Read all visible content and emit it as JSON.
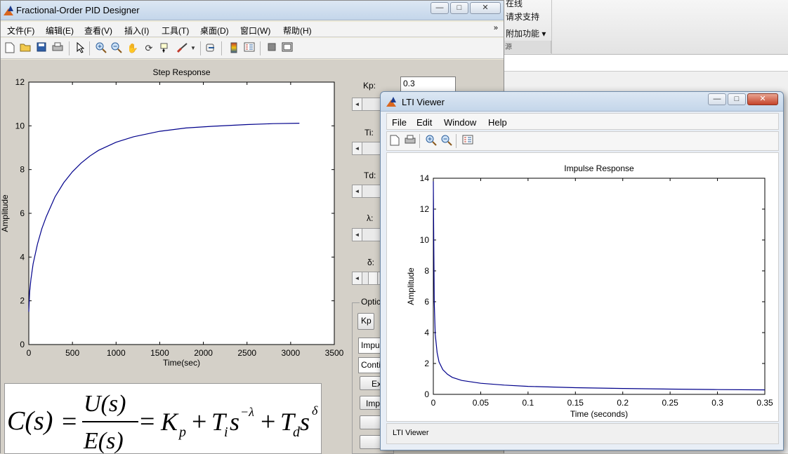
{
  "background_window": {
    "ribbon_items": [
      "在线",
      "请求支持",
      "附加功能 ▾"
    ],
    "group_label": "源"
  },
  "main_window": {
    "title": "Fractional-Order PID Designer",
    "controls": [
      "—",
      "□",
      "✕"
    ],
    "menu": [
      "文件(F)",
      "编辑(E)",
      "查看(V)",
      "插入(I)",
      "工具(T)",
      "桌面(D)",
      "窗口(W)",
      "帮助(H)"
    ],
    "menu_overflow": "»",
    "toolbar_icons": [
      "new-figure-icon",
      "open-icon",
      "save-icon",
      "print-icon",
      "pointer-icon",
      "zoom-in-icon",
      "zoom-out-icon",
      "pan-icon",
      "rotate-icon",
      "data-cursor-icon",
      "brush-icon",
      "link-icon",
      "colorbar-icon",
      "legend-icon",
      "hide-tools-icon",
      "show-tools-icon"
    ],
    "params": {
      "kp_label": "Kp:",
      "kp_value": "0.3",
      "ti_label": "Ti:",
      "td_label": "Td:",
      "lambda_label": "λ:",
      "delta_label": "δ:"
    },
    "options": {
      "title": "Optic",
      "kp_button": "Kp",
      "popup1": "Impu",
      "popup2": "Conti",
      "btn_ex": "Ex",
      "btn_imp": "Imp"
    },
    "equation": {
      "lhs": "C(s)",
      "num": "U(s)",
      "den": "E(s)",
      "kp": "K",
      "kp_sub": "p",
      "ti": "T",
      "ti_sub": "i",
      "lambda_exp": "−λ",
      "td": "T",
      "td_sub": "d",
      "delta_exp": "δ",
      "s": "s",
      "plus": "+",
      "eq": "="
    }
  },
  "lti_window": {
    "title": "LTI Viewer",
    "menu": [
      "File",
      "Edit",
      "Window",
      "Help"
    ],
    "toolbar_icons": [
      "new-icon",
      "print-icon",
      "zoom-in-icon",
      "zoom-out-icon",
      "legend-icon"
    ],
    "status": "LTI Viewer"
  },
  "chart_data": [
    {
      "type": "line",
      "title": "Step Response",
      "xlabel": "Time(sec)",
      "ylabel": "Amplitude",
      "xlim": [
        0,
        3500
      ],
      "ylim": [
        0,
        12
      ],
      "xticks": [
        0,
        500,
        1000,
        1500,
        2000,
        2500,
        3000,
        3500
      ],
      "yticks": [
        0,
        2,
        4,
        6,
        8,
        10,
        12
      ],
      "series": [
        {
          "color": "#00008b",
          "x": [
            0,
            10,
            25,
            50,
            100,
            150,
            200,
            300,
            400,
            500,
            600,
            700,
            800,
            1000,
            1200,
            1500,
            1800,
            2100,
            2500,
            2800,
            3100
          ],
          "y": [
            1.5,
            2.4,
            3.0,
            3.7,
            4.6,
            5.3,
            5.85,
            6.75,
            7.4,
            7.9,
            8.3,
            8.62,
            8.88,
            9.25,
            9.5,
            9.75,
            9.9,
            9.98,
            10.06,
            10.1,
            10.12
          ]
        }
      ]
    },
    {
      "type": "line",
      "title": "Impulse Response",
      "xlabel": "Time (seconds)",
      "ylabel": "Amplitude",
      "xlim": [
        0,
        0.35
      ],
      "ylim": [
        0,
        14
      ],
      "xticks": [
        0,
        0.05,
        0.1,
        0.15,
        0.2,
        0.25,
        0.3,
        0.35
      ],
      "xtick_labels": [
        "0",
        "0.05",
        "0.1",
        "0.15",
        "0.2",
        "0.25",
        "0.3",
        "0.35"
      ],
      "yticks": [
        0,
        2,
        4,
        6,
        8,
        10,
        12,
        14
      ],
      "series": [
        {
          "color": "#00008b",
          "x": [
            0,
            0.0005,
            0.001,
            0.002,
            0.004,
            0.006,
            0.01,
            0.015,
            0.02,
            0.03,
            0.05,
            0.075,
            0.1,
            0.15,
            0.2,
            0.25,
            0.3,
            0.35
          ],
          "y": [
            13.8,
            9.5,
            6.0,
            3.9,
            2.7,
            2.1,
            1.6,
            1.3,
            1.1,
            0.9,
            0.72,
            0.6,
            0.52,
            0.43,
            0.38,
            0.34,
            0.31,
            0.29
          ]
        }
      ]
    }
  ]
}
